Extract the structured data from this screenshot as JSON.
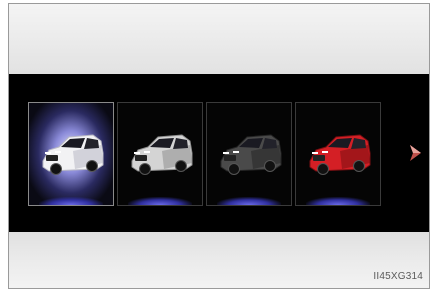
{
  "carousel": {
    "tiles": [
      {
        "name": "tile-vehicle-white",
        "selected": true,
        "body_color": "#f2f2f4",
        "shade_color": "#b8b8c4"
      },
      {
        "name": "tile-vehicle-silver",
        "selected": false,
        "body_color": "#d4d4d4",
        "shade_color": "#8e8e8e"
      },
      {
        "name": "tile-vehicle-dark",
        "selected": false,
        "body_color": "#4a4a4a",
        "shade_color": "#262626"
      },
      {
        "name": "tile-vehicle-red",
        "selected": false,
        "body_color": "#d41f25",
        "shade_color": "#7a0f12"
      }
    ],
    "next_icon": "chevron-right-icon",
    "accent_color": "#c0504a"
  },
  "footer": {
    "code": "II45XG314"
  }
}
